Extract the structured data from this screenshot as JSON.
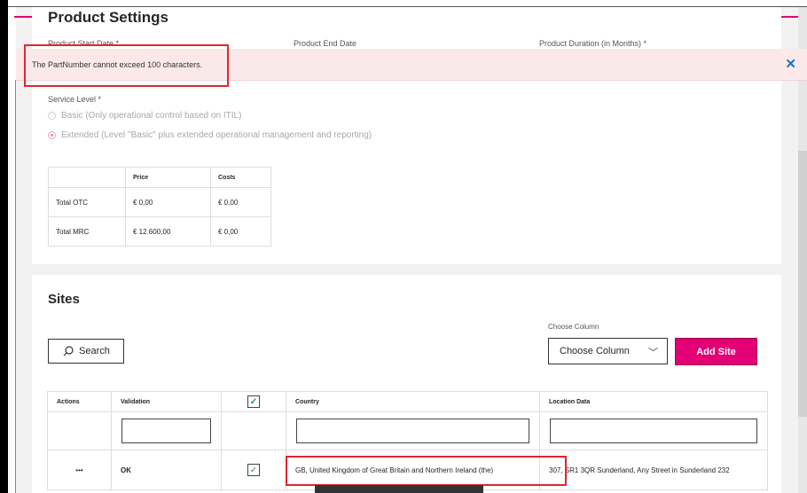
{
  "product_settings": {
    "title": "Product Settings",
    "start_date_label": "Product Start Date *",
    "end_date_label": "Product End Date",
    "duration_label": "Product Duration (in Months) *"
  },
  "alert": {
    "message": "The PartNumber cannot exceed 100 characters.",
    "close": "✕"
  },
  "service_level": {
    "label": "Service Level *",
    "options": [
      {
        "label": "Basic (Only operational control based on ITIL)",
        "checked": false
      },
      {
        "label": "Extended (Level \"Basic\" plus extended operational management and reporting)",
        "checked": true
      }
    ]
  },
  "price_table": {
    "headers": [
      "",
      "Price",
      "Costs"
    ],
    "rows": [
      [
        "Total OTC",
        "€ 0,00",
        "€ 0,00"
      ],
      [
        "Total MRC",
        "€ 12.600,00",
        "€ 0,00"
      ]
    ]
  },
  "sites": {
    "title": "Sites",
    "search_label": "Search",
    "choose_column_label": "Choose Column",
    "choose_column_value": "Choose Column",
    "add_site_label": "Add Site",
    "table": {
      "headers": [
        "Actions",
        "Validation",
        "",
        "Country",
        "Location Data"
      ],
      "rows": [
        {
          "actions": "•••",
          "validation": "OK",
          "checked": "✓",
          "country": "GB, United Kingdom of Great Britain and Northern Ireland (the)",
          "location": "307, SR1 3QR Sunderland, Any Street in Sunderland 232"
        }
      ]
    }
  },
  "colors": {
    "accent": "#e20074",
    "alert_bg": "#fbe9ea",
    "highlight": "#e0262e"
  }
}
